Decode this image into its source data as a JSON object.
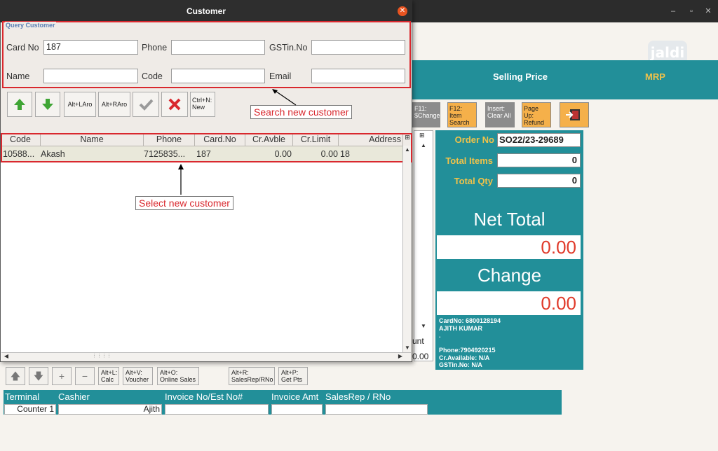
{
  "dialog": {
    "title": "Customer",
    "query": {
      "legend": "Query Customer",
      "card_no_label": "Card No",
      "card_no_value": "187",
      "phone_label": "Phone",
      "phone_value": "",
      "gstin_label": "GSTin.No",
      "gstin_value": "",
      "name_label": "Name",
      "name_value": "",
      "code_label": "Code",
      "code_value": "",
      "email_label": "Email",
      "email_value": ""
    },
    "buttons": {
      "alt_left": "Alt+LAro",
      "alt_right": "Alt+RAro",
      "ctrl_n_1": "Ctrl+N:",
      "ctrl_n_2": "New"
    },
    "table": {
      "columns": [
        "Code",
        "Name",
        "Phone",
        "Card.No",
        "Cr.Avble",
        "Cr.Limit",
        "Address"
      ],
      "rows": [
        [
          "10588...",
          "Akash",
          "7125835...",
          "187",
          "0.00",
          "0.00",
          "18"
        ]
      ]
    },
    "annotations": {
      "search": "Search new customer",
      "select": "Select new customer"
    }
  },
  "background": {
    "logo": "jaldi",
    "price_header": {
      "selling_price": "Selling Price",
      "mrp": "MRP"
    },
    "fkeys": [
      {
        "line1": "F11:",
        "line2": "$Change",
        "line3": ""
      },
      {
        "line1": "F12:",
        "line2": "Item",
        "line3": "Search"
      },
      {
        "line1": "Insert:",
        "line2": "Clear All",
        "line3": ""
      },
      {
        "line1": "Page Up:",
        "line2": "Refund",
        "line3": ""
      }
    ],
    "order": {
      "order_no_label": "Order No",
      "order_no_value": "SO22/23-29689",
      "total_items_label": "Total Items",
      "total_items_value": "0",
      "total_qty_label": "Total Qty",
      "total_qty_value": "0",
      "net_total_label": "Net Total",
      "net_total_value": "0.00",
      "change_label": "Change",
      "change_value": "0.00"
    },
    "customer_info": {
      "card": "CardNo: 6800128194",
      "name": "AJITH KUMAR",
      "dot": ".",
      "phone": "Phone:7904920215",
      "cr_available": "Cr.Available: N/A",
      "gstin": "GSTin.No: N/A"
    },
    "partial_text": {
      "unt": "unt",
      "amount": "0.00"
    },
    "toolbar": {
      "calc_1": "Alt+L:",
      "calc_2": "Calc",
      "voucher_1": "Alt+V:",
      "voucher_2": "Voucher",
      "online_1": "Alt+O:",
      "online_2": "Online Sales",
      "salesrep_1": "Alt+R:",
      "salesrep_2": "SalesRep/RNo",
      "points_1": "Alt+P:",
      "points_2": "Get Pts",
      "plus": "+",
      "minus": "−"
    },
    "bottom": {
      "terminal_label": "Terminal",
      "terminal_value": "Counter 1",
      "cashier_label": "Cashier",
      "cashier_value": "Ajith",
      "invoice_label": "Invoice No/Est No#",
      "invoice_value": "",
      "invoice_amt_label": "Invoice Amt",
      "invoice_amt_value": "",
      "salesrep_label": "SalesRep / RNo",
      "salesrep_value": ""
    }
  },
  "colors": {
    "teal": "#228f99",
    "accent_gold": "#f0c24a",
    "annotation_red": "#d9282e",
    "value_red": "#e03a2a",
    "close_orange": "#e95420"
  }
}
